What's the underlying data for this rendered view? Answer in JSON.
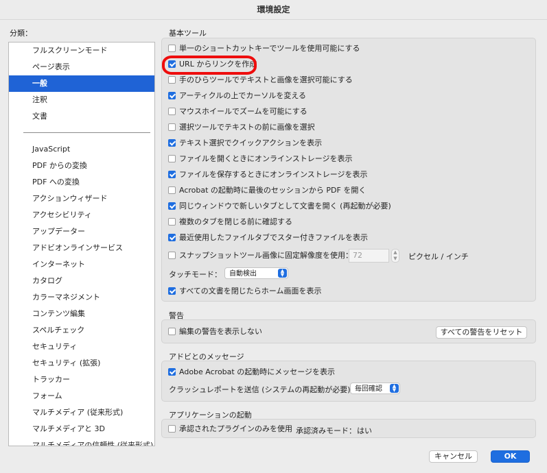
{
  "window": {
    "title": "環境設定"
  },
  "sidebar": {
    "label": "分類：",
    "group1": [
      "フルスクリーンモード",
      "ページ表示",
      "一般",
      "注釈",
      "文書"
    ],
    "selected": "一般",
    "group2": [
      "JavaScript",
      "PDF からの変換",
      "PDF への変換",
      "アクションウィザード",
      "アクセシビリティ",
      "アップデーター",
      "アドビオンラインサービス",
      "インターネット",
      "カタログ",
      "カラーマネジメント",
      "コンテンツ編集",
      "スペルチェック",
      "セキュリティ",
      "セキュリティ (拡張)",
      "トラッカー",
      "フォーム",
      "マルチメディア (従来形式)",
      "マルチメディアと 3D",
      "マルチメディアの信頼性 (従来形式)"
    ]
  },
  "basic_tools": {
    "label": "基本ツール",
    "options": [
      {
        "label": "単一のショートカットキーでツールを使用可能にする",
        "checked": false
      },
      {
        "label": "URL からリンクを作成",
        "checked": true
      },
      {
        "label": "手のひらツールでテキストと画像を選択可能にする",
        "checked": false
      },
      {
        "label": "アーティクルの上でカーソルを変える",
        "checked": true
      },
      {
        "label": "マウスホイールでズームを可能にする",
        "checked": false
      },
      {
        "label": "選択ツールでテキストの前に画像を選択",
        "checked": false
      },
      {
        "label": "テキスト選択でクイックアクションを表示",
        "checked": true
      },
      {
        "label": "ファイルを開くときにオンラインストレージを表示",
        "checked": false
      },
      {
        "label": "ファイルを保存するときにオンラインストレージを表示",
        "checked": true
      },
      {
        "label": "Acrobat の起動時に最後のセッションから PDF を開く",
        "checked": false
      },
      {
        "label": "同じウィンドウで新しいタブとして文書を開く (再起動が必要)",
        "checked": true
      },
      {
        "label": "複数のタブを閉じる前に確認する",
        "checked": false
      },
      {
        "label": "最近使用したファイルタブでスター付きファイルを表示",
        "checked": true
      }
    ],
    "snapshot": {
      "label": "スナップショットツール画像に固定解像度を使用：",
      "checked": false,
      "value": "72",
      "unit": "ピクセル / インチ"
    },
    "touch_mode": {
      "label": "タッチモード：",
      "value": "自動検出"
    },
    "home_on_close": {
      "label": "すべての文書を閉じたらホーム画面を表示",
      "checked": true
    }
  },
  "warnings": {
    "label": "警告",
    "hide_edit_warnings": {
      "label": "編集の警告を表示しない",
      "checked": false
    },
    "reset_button": "すべての警告をリセット"
  },
  "messages": {
    "label": "アドビとのメッセージ",
    "show_on_launch": {
      "label": "Adobe Acrobat の起動時にメッセージを表示",
      "checked": true
    },
    "crash_report": {
      "label": "クラッシュレポートを送信 (システムの再起動が必要):",
      "value": "毎回確認"
    }
  },
  "app_launch": {
    "label": "アプリケーションの起動",
    "approved_only": {
      "label": "承認されたプラグインのみを使用",
      "checked": false
    },
    "approved_mode_label": "承認済みモード：",
    "approved_mode_value": "はい"
  },
  "footer": {
    "cancel": "キャンセル",
    "ok": "OK"
  },
  "colors": {
    "accent": "#1f6ee0",
    "selection": "#1f63d6",
    "annotation": "#ee0d0d"
  }
}
